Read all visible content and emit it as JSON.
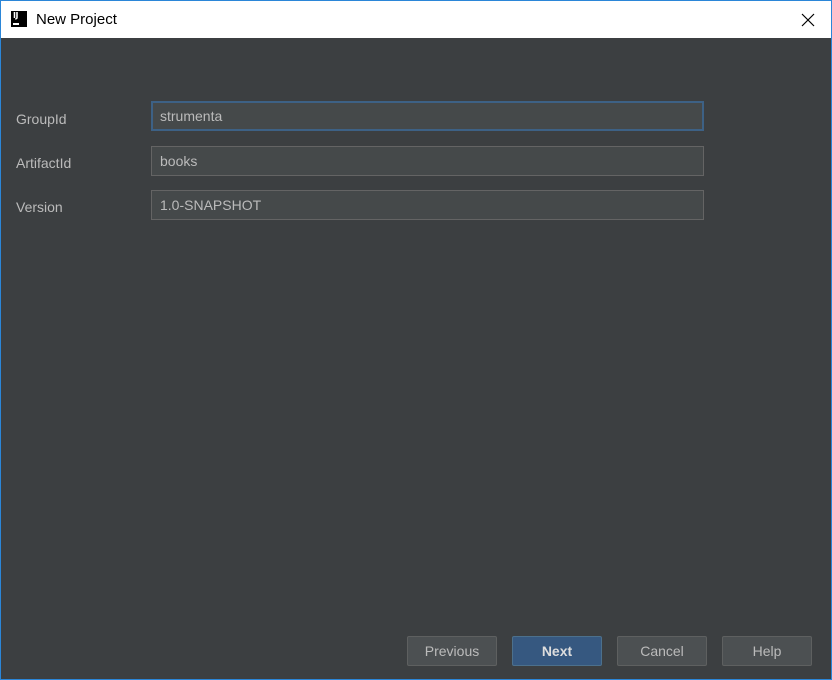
{
  "window": {
    "title": "New Project",
    "icon": "intellij-icon"
  },
  "form": {
    "fields": [
      {
        "label": "GroupId",
        "value": "strumenta"
      },
      {
        "label": "ArtifactId",
        "value": "books"
      },
      {
        "label": "Version",
        "value": "1.0-SNAPSHOT"
      }
    ]
  },
  "buttons": {
    "previous": "Previous",
    "next": "Next",
    "cancel": "Cancel",
    "help": "Help"
  },
  "colors": {
    "background": "#3c3f41",
    "input_background": "#45494a",
    "focus_border": "#3d6185",
    "primary_button": "#365880",
    "text": "#bbbbbb"
  }
}
